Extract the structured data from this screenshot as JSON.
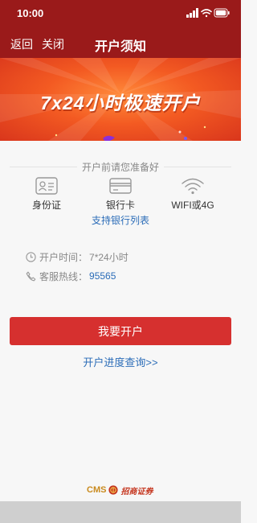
{
  "status_bar": {
    "time": "10:00"
  },
  "nav": {
    "back": "返回",
    "close": "关闭",
    "title": "开户须知"
  },
  "banner": {
    "slogan": "7x24小时极速开户"
  },
  "requirements": {
    "heading": "开户前请您准备好",
    "items": [
      {
        "label": "身份证",
        "icon": "id-card-icon"
      },
      {
        "label": "银行卡",
        "icon": "bank-card-icon"
      },
      {
        "label": "WIFI或4G",
        "icon": "wifi-icon"
      }
    ],
    "bank_list_link": "支持银行列表"
  },
  "info": {
    "hours_label": "开户时间：",
    "hours_value": "7*24小时",
    "hotline_label": "客服热线：",
    "hotline_value": "95565"
  },
  "actions": {
    "open_account": "我要开户",
    "progress_query": "开户进度查询>>"
  },
  "footer": {
    "brand_prefix": "CMS",
    "brand_name": "招商证券"
  },
  "colors": {
    "nav_bg": "#9a1a1a",
    "button": "#d6302f",
    "link": "#2c6db8",
    "banner": "#f35a22"
  }
}
